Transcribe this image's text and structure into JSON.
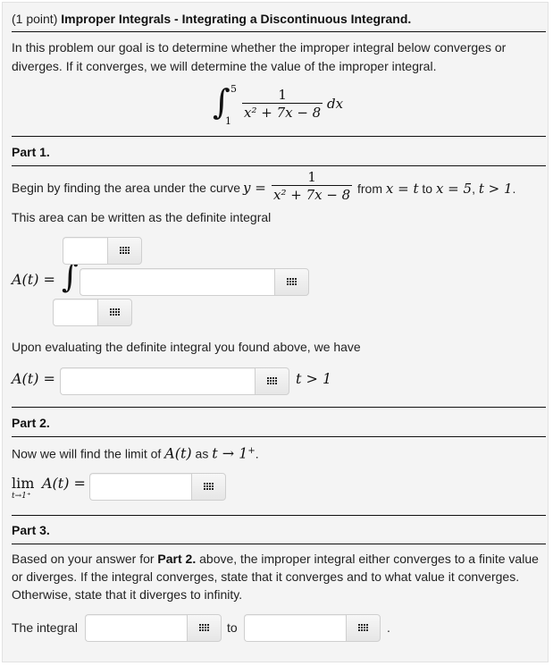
{
  "header": {
    "points": "(1 point)",
    "title": "Improper Integrals - Integrating a Discontinuous Integrand."
  },
  "intro": {
    "line1": "In this problem our goal is to determine whether the improper integral below converges or",
    "line2": "diverges. If it converges, we will determine the value of the improper integral."
  },
  "main_integral": {
    "lower": "1",
    "upper": "5",
    "numerator": "1",
    "denominator": "x² + 7x − 8",
    "differential": "dx"
  },
  "part1": {
    "heading": "Part 1.",
    "sentence_pre": "Begin by finding the area under the curve",
    "y_eq": "y =",
    "numerator": "1",
    "denominator": "x² + 7x − 8",
    "from": "from",
    "x_eq_t": "x = t",
    "to": "to",
    "x_eq_5": "x = 5",
    "comma": ",",
    "cond": "t > 1",
    "period": ".",
    "line2": "This area can be written as the definite integral",
    "at_label": "A(t) =",
    "integral_sign": "∫",
    "upper_limit_input": {
      "value": "",
      "placeholder": ""
    },
    "integrand_input": {
      "value": "",
      "placeholder": ""
    },
    "lower_limit_input": {
      "value": "",
      "placeholder": ""
    },
    "eval_text": "Upon evaluating the definite integral you found above, we have",
    "at_label2": "A(t) =",
    "result_input": {
      "value": "",
      "placeholder": ""
    },
    "result_cond": "t > 1"
  },
  "part2": {
    "heading": "Part 2.",
    "sentence_pre": "Now we will find the limit of",
    "at": "A(t)",
    "as": "as",
    "limit_expr": "t → 1",
    "sup": "+",
    "period": ".",
    "lim": "lim",
    "lim_sub": "t→1⁺",
    "lim_rhs": "A(t) =",
    "limit_input": {
      "value": "",
      "placeholder": ""
    }
  },
  "part3": {
    "heading": "Part 3.",
    "text_pre": "Based on your answer for",
    "text_bold": "Part 2.",
    "text_post": "above, the improper integral either converges to a finite value",
    "line2": "or diverges. If the integral converges, state that it converges and to what value it converges.",
    "line3": "Otherwise, state that it diverges to infinity.",
    "label": "The integral",
    "to": "to",
    "period": ".",
    "verb_input": {
      "value": "",
      "placeholder": ""
    },
    "value_input": {
      "value": "",
      "placeholder": ""
    }
  },
  "icons": {
    "palette": "equation-palette-grid-icon"
  }
}
